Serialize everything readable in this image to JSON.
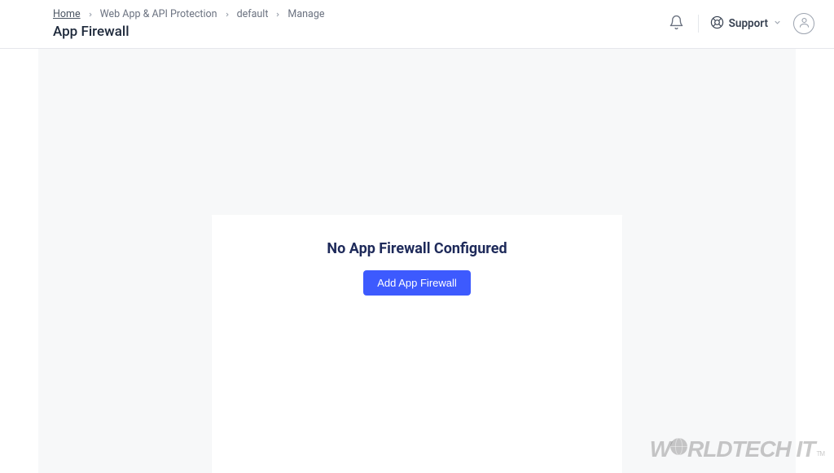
{
  "breadcrumb": {
    "items": [
      {
        "label": "Home"
      },
      {
        "label": "Web App & API Protection"
      },
      {
        "label": "default"
      },
      {
        "label": "Manage"
      }
    ]
  },
  "page": {
    "title": "App Firewall"
  },
  "header": {
    "support_label": "Support"
  },
  "empty_state": {
    "title": "No App Firewall Configured",
    "button_label": "Add App Firewall"
  },
  "watermark": {
    "part1": "W",
    "part2": "RLDTECH IT",
    "tm": "TM"
  }
}
